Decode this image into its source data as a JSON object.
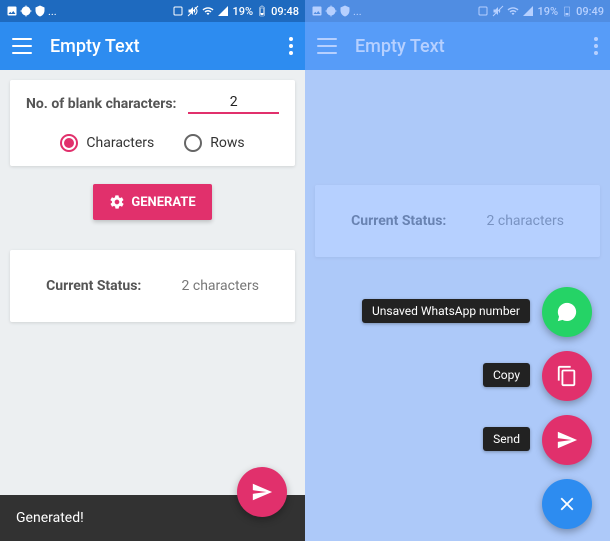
{
  "status_bar": {
    "battery_pct": "19%",
    "time_left": "09:48",
    "time_right": "09:49"
  },
  "appbar": {
    "title": "Empty Text"
  },
  "input": {
    "label": "No. of blank characters:",
    "value": "2"
  },
  "radio": {
    "characters": "Characters",
    "rows": "Rows"
  },
  "generate_btn": "GENERATE",
  "status": {
    "label": "Current Status:",
    "value": "2 characters"
  },
  "toast": "Generated!",
  "fab_labels": {
    "whatsapp": "Unsaved WhatsApp number",
    "copy": "Copy",
    "send": "Send"
  },
  "ellipsis": "..."
}
